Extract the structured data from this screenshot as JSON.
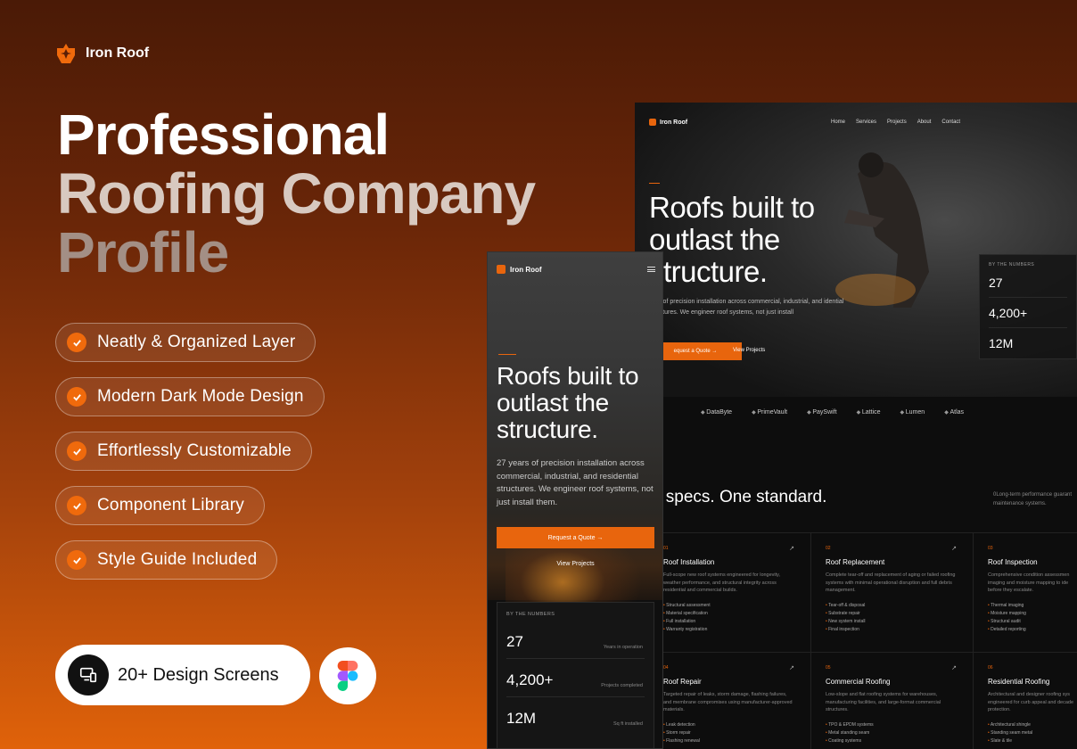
{
  "brand": {
    "name": "Iron Roof"
  },
  "hero": {
    "line1": "Professional",
    "line2": "Roofing Company",
    "line3": "Profile"
  },
  "features": [
    "Neatly & Organized Layer",
    "Modern Dark Mode Design",
    "Effortlessly Customizable",
    "Component Library",
    "Style Guide Included"
  ],
  "screens": {
    "label": "20+ Design Screens"
  },
  "colors": {
    "accent": "#e8650d",
    "check": "#f06a0c"
  },
  "desktop": {
    "brand": "Iron Roof",
    "nav": [
      "Home",
      "Services",
      "Projects",
      "About",
      "Contact"
    ],
    "headline": [
      "Roofs built to",
      "outlast the",
      "structure."
    ],
    "subtext": "ears of precision installation across commercial, industrial, and idential structures. We engineer roof systems, not just install",
    "cta_primary": "equest a Quote →",
    "cta_secondary": "View Projects",
    "stats_header": "BY THE NUMBERS",
    "stats": [
      "27",
      "4,200+",
      "12M"
    ],
    "logos": [
      "DataByte",
      "PrimeVault",
      "PaySwift",
      "Lattice",
      "Lumen",
      "Atlas"
    ],
    "specs_title": "x specs. One standard.",
    "specs_side": "0Long-term performance guarant maintenance systems.",
    "services": [
      {
        "num": "01",
        "title": "Roof Installation",
        "desc": "Full-scope new roof systems engineered for longevity, weather performance, and structural integrity across residential and commercial builds.",
        "items": [
          "Structural assessment",
          "Material specification",
          "Full installation",
          "Warranty registration"
        ]
      },
      {
        "num": "02",
        "title": "Roof Replacement",
        "desc": "Complete tear-off and replacement of aging or failed roofing systems with minimal operational disruption and full debris management.",
        "items": [
          "Tear-off & disposal",
          "Substrate repair",
          "New system install",
          "Final inspection"
        ]
      },
      {
        "num": "03",
        "title": "Roof Inspection",
        "desc": "Comprehensive condition assessmen imaging and moisture mapping to ide before they escalate.",
        "items": [
          "Thermal imaging",
          "Moisture mapping",
          "Structural audit",
          "Detailed reporting"
        ]
      },
      {
        "num": "04",
        "title": "Roof Repair",
        "desc": "Targeted repair of leaks, storm damage, flashing failures, and membrane compromises using manufacturer-approved materials.",
        "items": [
          "Leak detection",
          "Storm repair",
          "Flashing renewal"
        ]
      },
      {
        "num": "05",
        "title": "Commercial Roofing",
        "desc": "Low-slope and flat roofing systems for warehouses, manufacturing facilities, and large-format commercial structures.",
        "items": [
          "TPO & EPDM systems",
          "Metal standing seam",
          "Coating systems"
        ]
      },
      {
        "num": "06",
        "title": "Residential Roofing",
        "desc": "Architectural and designer roofing sys engineered for curb appeal and decade protection.",
        "items": [
          "Architectural shingle",
          "Standing seam metal",
          "Slate & tile"
        ]
      }
    ]
  },
  "mobile": {
    "brand": "Iron Roof",
    "headline": [
      "Roofs built to",
      "outlast the",
      "structure."
    ],
    "subtext": "27 years of precision installation across commercial, industrial, and residential structures. We engineer roof systems, not just install them.",
    "cta_primary": "Request a Quote →",
    "cta_secondary": "View Projects",
    "stats_header": "BY THE NUMBERS",
    "stats": [
      {
        "value": "27",
        "label": "Years in operation"
      },
      {
        "value": "4,200+",
        "label": "Projects completed"
      },
      {
        "value": "12M",
        "label": "Sq ft installed"
      }
    ]
  }
}
